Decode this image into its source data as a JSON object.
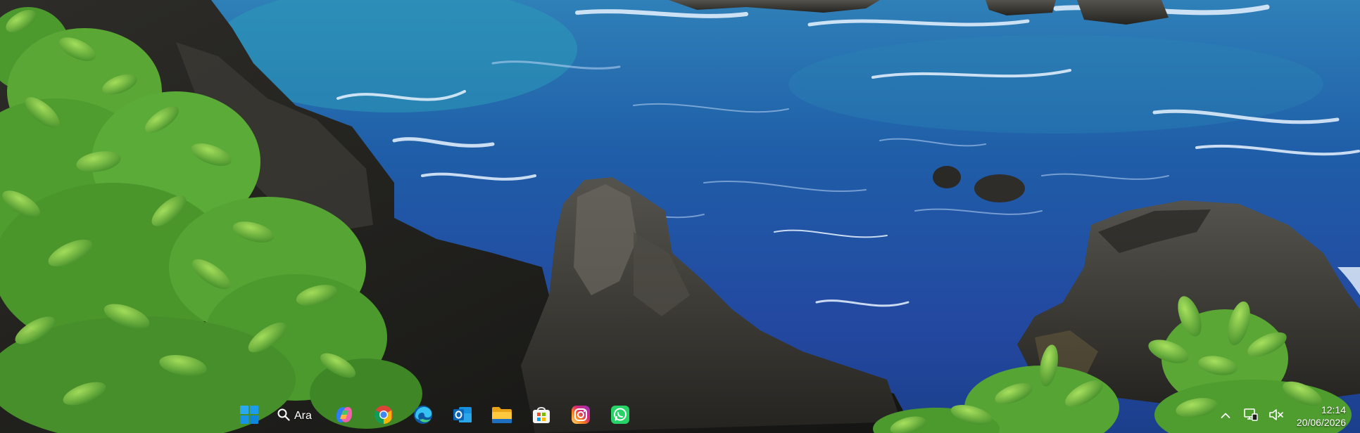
{
  "taskbar": {
    "search_label": "Ara",
    "pinned_apps": [
      {
        "name": "start-button",
        "icon": "windows-logo-icon"
      },
      {
        "name": "copilot",
        "icon": "copilot-icon"
      },
      {
        "name": "chrome",
        "icon": "chrome-icon"
      },
      {
        "name": "edge",
        "icon": "edge-icon"
      },
      {
        "name": "outlook",
        "icon": "outlook-icon"
      },
      {
        "name": "file-explorer",
        "icon": "folder-icon"
      },
      {
        "name": "microsoft-store",
        "icon": "store-icon"
      },
      {
        "name": "instagram",
        "icon": "instagram-icon"
      },
      {
        "name": "whatsapp",
        "icon": "whatsapp-icon"
      }
    ]
  },
  "tray": {
    "icons": [
      "chevron-up-icon",
      "network-icon",
      "volume-muted-icon"
    ],
    "time": "12:14",
    "date": "20/06/2026"
  },
  "colors": {
    "ocean": "#1d5aa3",
    "rock": "#3a3936",
    "foliage": "#5fae3c",
    "accent_windows": "#0a8ee8"
  }
}
